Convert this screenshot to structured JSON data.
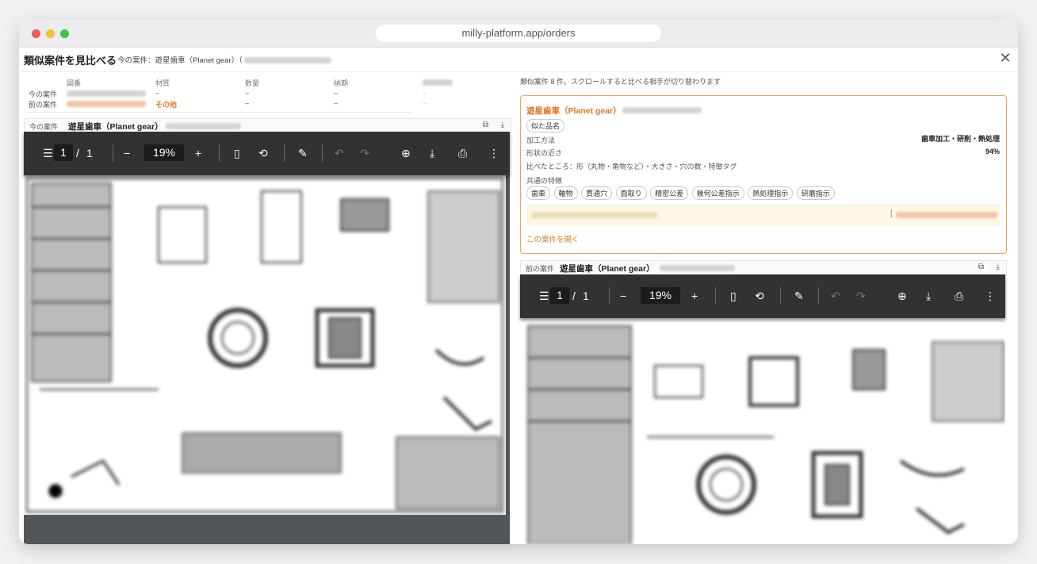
{
  "browser": {
    "url": "milly-platform.app/orders"
  },
  "dialog": {
    "title": "類似案件を見比べる",
    "current_prefix": "今の案件：遊星歯車（Planet gear）（"
  },
  "info_table": {
    "headers": [
      "図番",
      "材質",
      "数量",
      "納期"
    ],
    "rows": [
      {
        "label": "今の案件",
        "material": "–",
        "qty": "–",
        "due": "–"
      },
      {
        "label": "前の案件",
        "material": "その他",
        "qty": "–",
        "due": "–"
      }
    ],
    "extra_dash": "–"
  },
  "left_file": {
    "label": "今の案件",
    "name": "遊星歯車（Planet gear）",
    "external_icon": "⧉",
    "download_icon": "⤓"
  },
  "right_file": {
    "label": "前の案件",
    "name": "遊星歯車（Planet gear）",
    "external_icon": "⧉",
    "download_icon": "⤓"
  },
  "pdf_viewer": {
    "menu_icon": "☰",
    "page_current": "1",
    "page_sep": "/",
    "page_total": "1",
    "zoom_out": "−",
    "zoom": "19%",
    "zoom_in": "+",
    "fit_icon": "▯",
    "rotate_icon": "⟲",
    "draw_icon": "✎",
    "undo_icon": "↶",
    "redo_icon": "↷",
    "add_text_icon": "⊕",
    "download_icon": "⤓",
    "print_icon": "⎙",
    "more_icon": "⋮"
  },
  "similar": {
    "summary": "類似案件 8 件。スクロールすると比べる相手が切り替わります",
    "card": {
      "title": "遊星歯車（Planet gear）",
      "badge": "似た品名",
      "method_label": "加工方法",
      "method_value": "歯車加工・研削・熱処理",
      "shape_label": "形状の近さ",
      "shape_value": "94%",
      "compared_label": "比べたところ：形（丸物・角物など）・大きさ・穴の数・特徴タグ",
      "common_label": "共通の特徴",
      "tags": [
        "歯車",
        "軸物",
        "貫通穴",
        "面取り",
        "精密公差",
        "幾何公差指示",
        "熱処理指示",
        "研磨指示"
      ],
      "note_bracket": "[",
      "open_link": "この案件を開く"
    }
  },
  "colors": {
    "accent": "#e07820",
    "toolbar": "#323232",
    "viewer_bg": "#525659"
  }
}
